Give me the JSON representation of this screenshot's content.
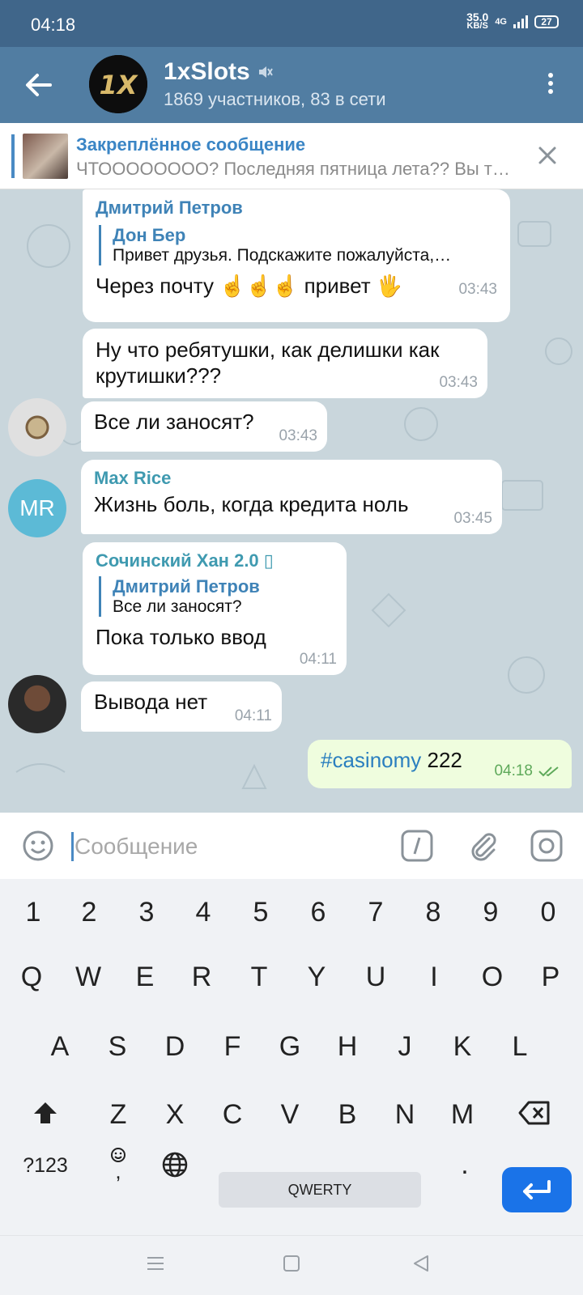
{
  "status": {
    "time": "04:18",
    "speed_value": "35.0",
    "speed_unit": "KB/S",
    "signal": "4G",
    "battery": "27"
  },
  "header": {
    "title": "1xSlots",
    "subtitle": "1869 участников, 83 в сети",
    "logo_text": "1X"
  },
  "pinned": {
    "title": "Закреплённое сообщение",
    "text": "ЧТОООООООО?  Последняя пятница лета?? Вы т…"
  },
  "messages": [
    {
      "sender": "Дмитрий Петров",
      "reply_name": "Дон Бер",
      "reply_text": "Привет друзья. Подскажите пожалуйста,…",
      "text": "Через почту ☝️☝️☝️ привет 🖐",
      "time": "03:43"
    },
    {
      "text": "Ну что ребятушки, как делишки как крутишки???",
      "time": "03:43"
    },
    {
      "text": "Все ли заносят?",
      "time": "03:43"
    },
    {
      "sender": "Max Rice",
      "avatar_initials": "MR",
      "text": "Жизнь боль, когда кредита ноль",
      "time": "03:45"
    },
    {
      "sender": "Сочинский Хан 2.0 ▯",
      "reply_name": "Дмитрий Петров",
      "reply_text": "Все ли заносят?",
      "text": "Пока только ввод",
      "time": "04:11"
    },
    {
      "text": "Вывода нет",
      "time": "04:11"
    },
    {
      "hashtag": "#casinomy",
      "text": " 222",
      "time": "04:18"
    }
  ],
  "input": {
    "placeholder": "Сообщение"
  },
  "keyboard": {
    "numbers": [
      "1",
      "2",
      "3",
      "4",
      "5",
      "6",
      "7",
      "8",
      "9",
      "0"
    ],
    "row1": [
      "Q",
      "W",
      "E",
      "R",
      "T",
      "Y",
      "U",
      "I",
      "O",
      "P"
    ],
    "row2": [
      "A",
      "S",
      "D",
      "F",
      "G",
      "H",
      "J",
      "K",
      "L"
    ],
    "row3": [
      "Z",
      "X",
      "C",
      "V",
      "B",
      "N",
      "M"
    ],
    "symbols_key": "?123",
    "comma_key": ",",
    "space_label": "QWERTY",
    "period_key": "."
  },
  "colors": {
    "header": "#517da2",
    "status": "#40668a",
    "accent": "#3a85c5",
    "outgoing": "#effdde"
  }
}
